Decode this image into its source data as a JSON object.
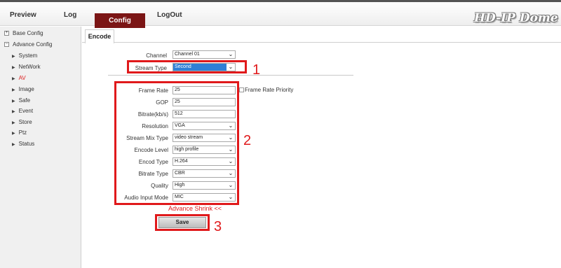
{
  "nav": {
    "preview": "Preview",
    "log": "Log",
    "config": "Config",
    "logout": "LogOut"
  },
  "brand": "HD-IP Dome",
  "sidebar": {
    "base_config": "Base Config",
    "advance_config": "Advance Config",
    "items": [
      "System",
      "NetWork",
      "AV",
      "Image",
      "Safe",
      "Event",
      "Store",
      "Ptz",
      "Status"
    ],
    "active": "AV"
  },
  "tab": "Encode",
  "form": {
    "channel": {
      "label": "Channel",
      "value": "Channel 01"
    },
    "stream_type": {
      "label": "Stream Type",
      "value": "Second"
    },
    "frame_rate": {
      "label": "Frame Rate",
      "value": "25"
    },
    "frame_rate_priority": "Frame Rate Priority",
    "gop": {
      "label": "GOP",
      "value": "25"
    },
    "bitrate": {
      "label": "Bitrate(kb/s)",
      "value": "512"
    },
    "resolution": {
      "label": "Resolution",
      "value": "VGA"
    },
    "stream_mix_type": {
      "label": "Stream Mix Type",
      "value": "video stream"
    },
    "encode_level": {
      "label": "Encode Level",
      "value": "high profile"
    },
    "encod_type": {
      "label": "Encod Type",
      "value": "H.264"
    },
    "bitrate_type": {
      "label": "Bitrate Type",
      "value": "CBR"
    },
    "quality": {
      "label": "Quality",
      "value": "High"
    },
    "audio_input_mode": {
      "label": "Audio Input Mode",
      "value": "MIC"
    }
  },
  "advance_shrink": "Advance Shrink <<",
  "save_label": "Save",
  "annotations": [
    "1",
    "2",
    "3"
  ],
  "colors": {
    "accent": "#7b1515",
    "highlight_red": "#e0191b",
    "select_blue": "#2f7fd6"
  }
}
